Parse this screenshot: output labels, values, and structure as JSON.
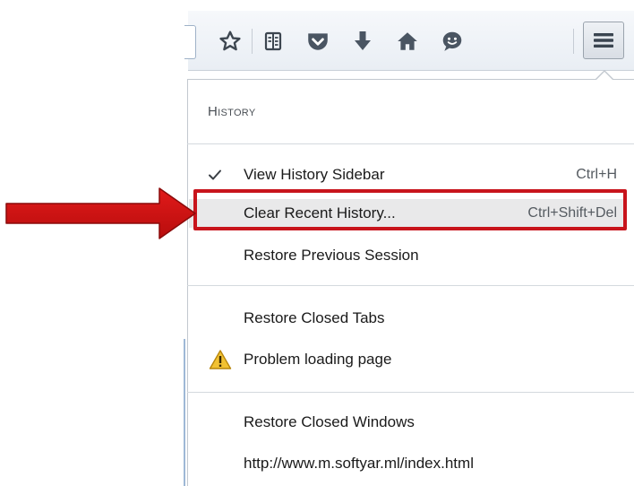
{
  "toolbar": {
    "icons": [
      "star-icon",
      "reading-list-icon",
      "pocket-icon",
      "download-icon",
      "home-icon",
      "chat-icon",
      "hamburger-menu-icon"
    ]
  },
  "history_panel": {
    "header": "History",
    "items": [
      {
        "label": "View History Sidebar",
        "shortcut": "Ctrl+H",
        "checked": true
      },
      {
        "label": "Clear Recent History...",
        "shortcut": "Ctrl+Shift+Del",
        "highlighted": true
      },
      {
        "label": "Restore Previous Session"
      }
    ],
    "closed_tabs": {
      "label": "Restore Closed Tabs",
      "tabs": [
        {
          "label": "Problem loading page",
          "icon": "warning-icon"
        }
      ]
    },
    "closed_windows": {
      "label": "Restore Closed Windows",
      "windows": [
        {
          "label": "http://www.m.softyar.ml/index.html"
        }
      ]
    }
  },
  "colors": {
    "annotation_red": "#c8141c",
    "hover_bg": "#e9e9ea",
    "icon_gray": "#5a6470"
  }
}
